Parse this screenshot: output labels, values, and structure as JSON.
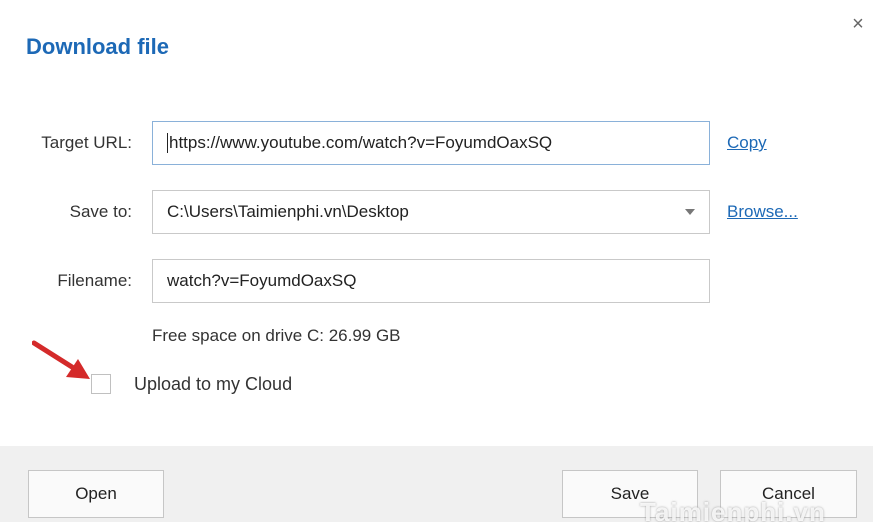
{
  "dialog": {
    "title": "Download file",
    "close_symbol": "×"
  },
  "form": {
    "target_url_label": "Target URL:",
    "target_url_value": "https://www.youtube.com/watch?v=FoyumdOaxSQ",
    "copy_link": "Copy",
    "save_to_label": "Save to:",
    "save_to_value": "C:\\Users\\Taimienphi.vn\\Desktop",
    "browse_link": "Browse...",
    "filename_label": "Filename:",
    "filename_value": "watch?v=FoyumdOaxSQ",
    "free_space": "Free space on drive C: 26.99 GB",
    "upload_label": "Upload to my Cloud",
    "upload_checked": false
  },
  "footer": {
    "open_label": "Open",
    "save_label": "Save",
    "cancel_label": "Cancel"
  },
  "watermark": "Taimienphi.vn",
  "colors": {
    "title": "#1d69b6",
    "link": "#1d69b6",
    "footer_bg": "#f0f0f0",
    "arrow": "#d42a2a"
  },
  "icons": {
    "close": "close-icon",
    "dropdown": "chevron-down-icon",
    "annotation": "red-arrow-icon"
  }
}
